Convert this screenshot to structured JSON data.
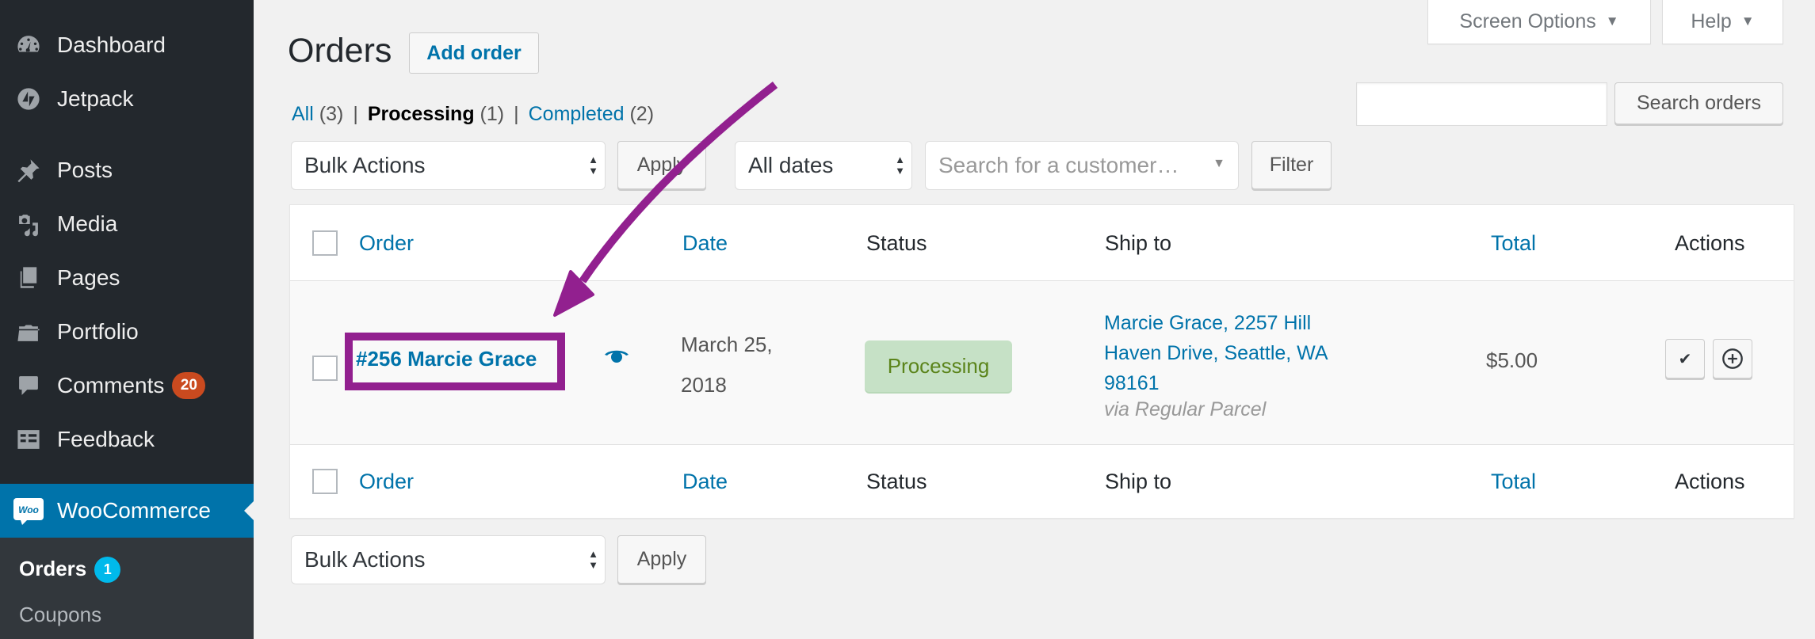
{
  "sidebar": {
    "items": [
      {
        "label": "Dashboard",
        "icon": "dashboard-icon"
      },
      {
        "label": "Jetpack",
        "icon": "jetpack-icon"
      },
      {
        "label": "Posts",
        "icon": "pin-icon"
      },
      {
        "label": "Media",
        "icon": "media-icon"
      },
      {
        "label": "Pages",
        "icon": "pages-icon"
      },
      {
        "label": "Portfolio",
        "icon": "folder-icon"
      },
      {
        "label": "Comments",
        "icon": "comment-icon",
        "badge": "20"
      },
      {
        "label": "Feedback",
        "icon": "feedback-icon"
      },
      {
        "label": "WooCommerce",
        "icon": "woo-icon",
        "active": true,
        "icon_text": "Woo"
      }
    ],
    "submenu": [
      {
        "label": "Orders",
        "badge": "1",
        "current": true
      },
      {
        "label": "Coupons"
      }
    ]
  },
  "screen_meta": {
    "screen_options": "Screen Options",
    "help": "Help",
    "caret": "▼"
  },
  "header": {
    "title": "Orders",
    "add_button": "Add order"
  },
  "views": {
    "all": {
      "label": "All",
      "count": "(3)"
    },
    "processing": {
      "label": "Processing",
      "count": "(1)"
    },
    "completed": {
      "label": "Completed",
      "count": "(2)"
    },
    "separator": "|"
  },
  "search": {
    "value": "",
    "button": "Search orders"
  },
  "filters": {
    "bulk_actions": "Bulk Actions",
    "apply": "Apply",
    "dates": "All dates",
    "customer_placeholder": "Search for a customer…",
    "filter_button": "Filter"
  },
  "table": {
    "columns": [
      "Order",
      "Date",
      "Status",
      "Ship to",
      "Total",
      "Actions"
    ],
    "sortable": [
      true,
      true,
      false,
      false,
      true,
      false
    ],
    "rows": [
      {
        "order": "#256 Marcie Grace",
        "date_line1": "March 25,",
        "date_line2": "2018",
        "status": "Processing",
        "ship_to_lines": [
          "Marcie Grace, 2257 Hill",
          "Haven Drive, Seattle, WA",
          "98161"
        ],
        "ship_via": "via Regular Parcel",
        "total": "$5.00",
        "actions": [
          "complete-action",
          "processing-action"
        ]
      }
    ]
  },
  "bottom": {
    "bulk_actions": "Bulk Actions",
    "apply": "Apply"
  },
  "colors": {
    "accent": "#0073aa",
    "annotation": "#92208f",
    "status_processing_bg": "#c6e1c6",
    "status_processing_text": "#5b841b",
    "comments_badge": "#ca4a1f",
    "orders_badge": "#00b9eb"
  }
}
